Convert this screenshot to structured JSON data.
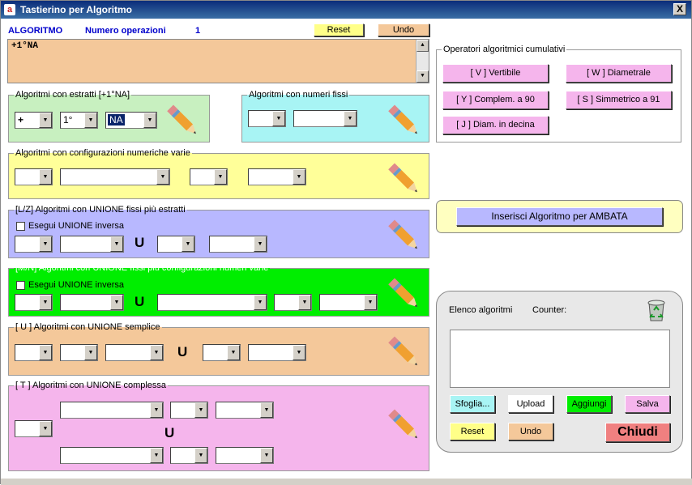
{
  "window": {
    "title": "Tastierino per Algoritmo",
    "app_icon": "app-logo-icon",
    "close_label": "X"
  },
  "header": {
    "algoritmo_label": "ALGORITMO",
    "num_op_label": "Numero operazioni",
    "num_op_value": "1",
    "reset_label": "Reset",
    "undo_label": "Undo"
  },
  "textarea": {
    "value": "+1°NA"
  },
  "estratti": {
    "legend": "Algoritmi con estratti  [+1°NA]",
    "sel1": "+",
    "sel2": "1°",
    "sel3": "NA"
  },
  "fissi": {
    "legend": "Algoritmi con numeri fissi"
  },
  "config": {
    "legend": "Algoritmi con configurazioni numeriche varie"
  },
  "lz": {
    "legend": "[L/Z] Algoritmi con UNIONE fissi più estratti",
    "checkbox_label": "Esegui UNIONE inversa",
    "u": "U"
  },
  "mn": {
    "legend": "[M/N] Algoritmi con UNIONE fissi più configurazioni numeri varie",
    "checkbox_label": "Esegui UNIONE inversa",
    "u": "U"
  },
  "u": {
    "legend": "[ U ] Algoritmi con UNIONE semplice",
    "u": "U"
  },
  "t": {
    "legend": "[ T ] Algoritmi con UNIONE complessa",
    "u": "U"
  },
  "operators": {
    "legend": "Operatori algoritmici cumulativi",
    "v": "[ V ] Vertibile",
    "w": "[ W ] Diametrale",
    "y": "[ Y ] Complem. a 90",
    "s": "[ S ] Simmetrico  a 91",
    "j": "[ J ] Diam. in decina"
  },
  "ambata": {
    "label": "Inserisci Algoritmo per AMBATA"
  },
  "elenco": {
    "label": "Elenco algoritmi",
    "counter_label": "Counter:",
    "sfoglia": "Sfoglia...",
    "upload": "Upload",
    "aggiungi": "Aggiungi",
    "salva": "Salva",
    "reset": "Reset",
    "undo": "Undo",
    "chiudi": "Chiudi"
  },
  "colors": {
    "estratti_bg": "#c8f0c0",
    "fissi_bg": "#a8f4f4",
    "config_bg": "#ffff99",
    "lz_bg": "#b8b8ff",
    "mn_bg": "#00ee00",
    "u_bg": "#f4c89a",
    "t_bg": "#f5b5ec",
    "chiudi_bg": "#f08080"
  }
}
